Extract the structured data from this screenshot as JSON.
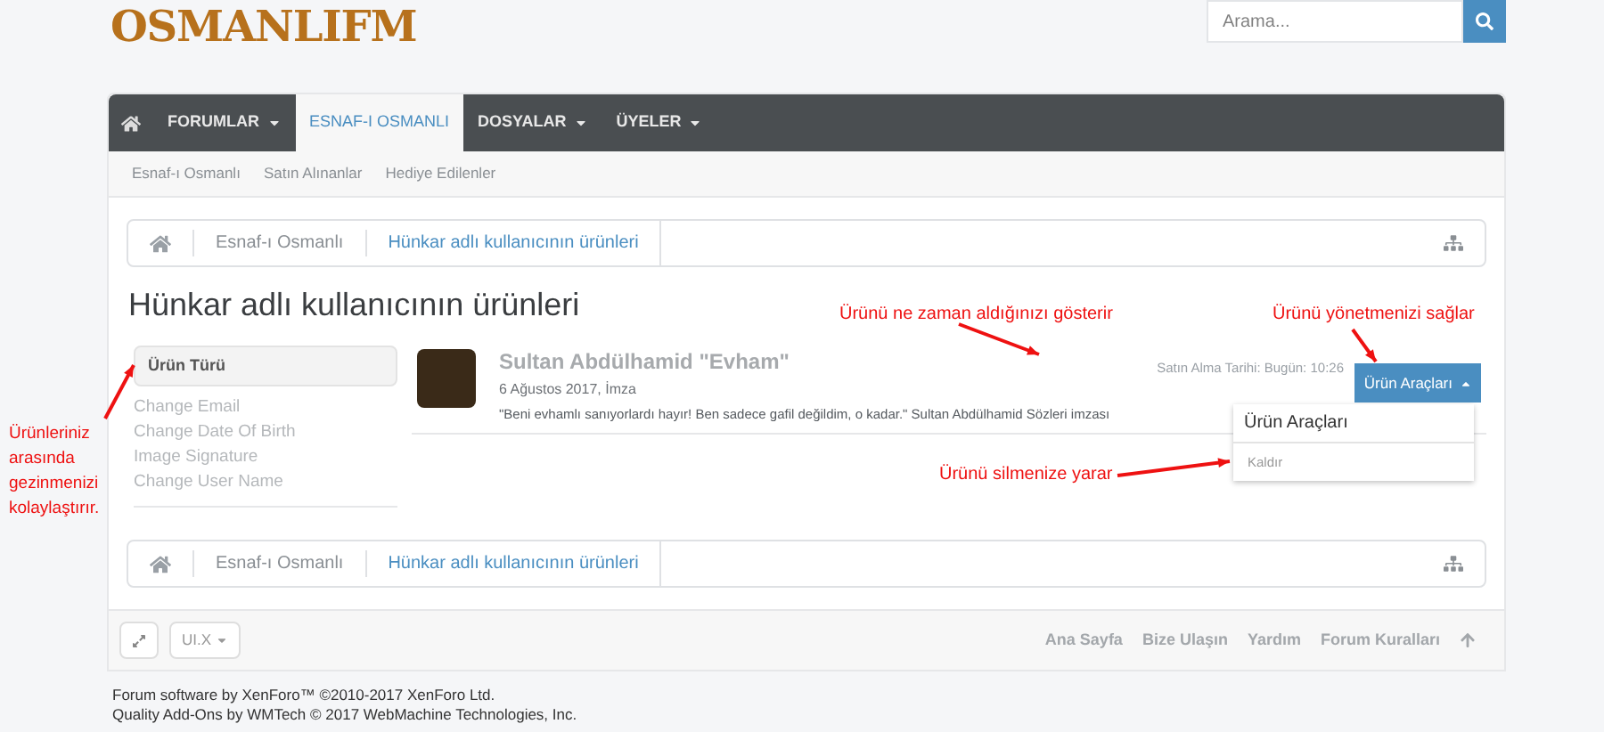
{
  "logo": {
    "text": "OSMANLIFM"
  },
  "search": {
    "placeholder": "Arama..."
  },
  "nav": {
    "tabs": [
      {
        "label": "FORUMLAR",
        "dropdown": true,
        "selected": false
      },
      {
        "label": "ESNAF-I OSMANLI",
        "dropdown": false,
        "selected": true
      },
      {
        "label": "DOSYALAR",
        "dropdown": true,
        "selected": false
      },
      {
        "label": "ÜYELER",
        "dropdown": true,
        "selected": false
      }
    ],
    "subnav": [
      "Esnaf-ı Osmanlı",
      "Satın Alınanlar",
      "Hediye Edilenler"
    ]
  },
  "breadcrumb_top": [
    "Esnaf-ı Osmanlı",
    "Hünkar adlı kullanıcının ürünleri"
  ],
  "page_title": "Hünkar adlı kullanıcının ürünleri",
  "sidebar": {
    "heading": "Ürün Türü",
    "items": [
      "Change Email",
      "Change Date Of Birth",
      "Image Signature",
      "Change User Name"
    ]
  },
  "product": {
    "title": "Sultan Abdülhamid \"Evham\"",
    "meta": "6 Ağustos 2017, İmza",
    "description": "\"Beni evhamlı sanıyorlardı hayır! Ben sadece gafil değildim, o kadar.\" Sultan Abdülhamid Sözleri imzası",
    "purchase_date": "Satın Alma Tarihi: Bugün: 10:26",
    "tools_button": "Ürün Araçları",
    "menu": {
      "expanded": true,
      "heading": "Ürün Araçları",
      "items": [
        "Kaldır"
      ]
    }
  },
  "annotations": [
    "Ürünü ne zaman aldığınızı gösterir",
    "Ürünü yönetmenizi sağlar",
    "Ürünleriniz arasında gezinmenizi kolaylaştırır.",
    "Ürünü silmenize yarar"
  ],
  "breadcrumb_bottom": [
    "Esnaf-ı Osmanlı",
    "Hünkar adlı kullanıcının ürünleri"
  ],
  "footer": {
    "style_chooser": "UI.X",
    "links": [
      "Ana Sayfa",
      "Bize Ulaşın",
      "Yardım",
      "Forum Kuralları"
    ]
  },
  "copyright": [
    "Forum software by XenForo™ ©2010-2017 XenForo Ltd.",
    "Quality Add-Ons by WMTech © 2017 WebMachine Technologies, Inc."
  ]
}
